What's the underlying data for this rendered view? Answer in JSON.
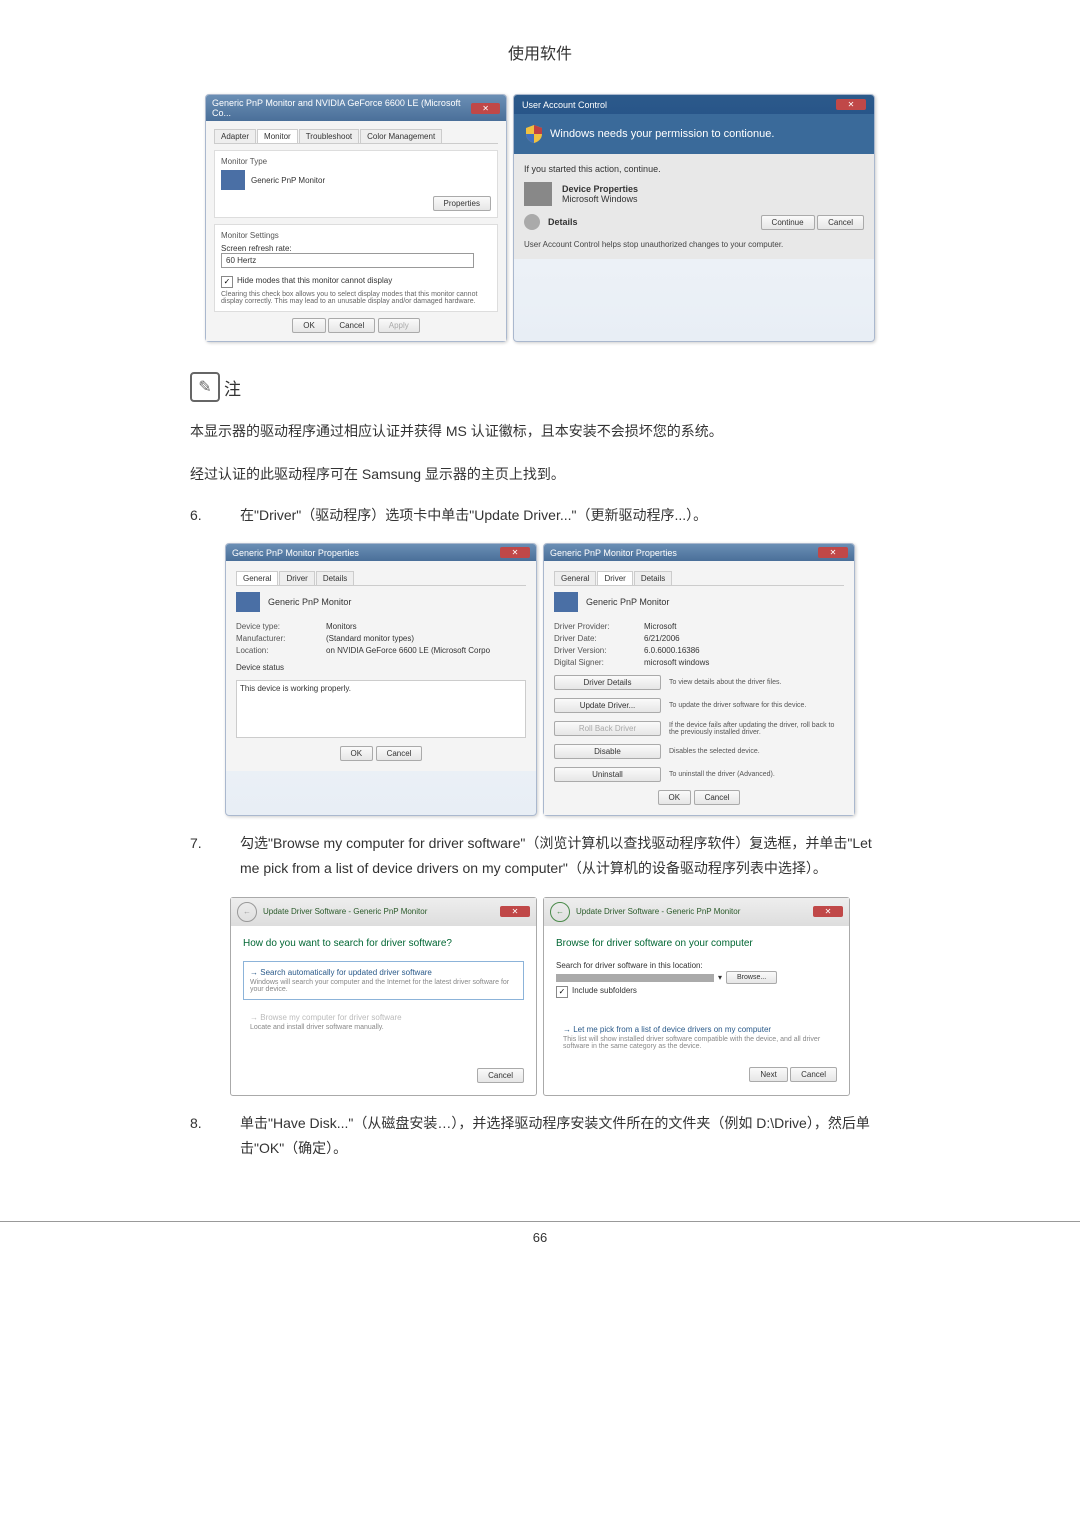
{
  "header": {
    "title": "使用软件"
  },
  "shot1": {
    "title": "Generic PnP Monitor and NVIDIA GeForce 6600 LE (Microsoft Co...",
    "tabs": [
      "Adapter",
      "Monitor",
      "Troubleshoot",
      "Color Management"
    ],
    "monitorType": "Monitor Type",
    "deviceName": "Generic PnP Monitor",
    "propertiesBtn": "Properties",
    "settingsTitle": "Monitor Settings",
    "refreshLabel": "Screen refresh rate:",
    "refreshValue": "60 Hertz",
    "hideModes": "Hide modes that this monitor cannot display",
    "hideDesc": "Clearing this check box allows you to select display modes that this monitor cannot display correctly. This may lead to an unusable display and/or damaged hardware.",
    "ok": "OK",
    "cancel": "Cancel",
    "apply": "Apply"
  },
  "uac": {
    "title": "User Account Control",
    "banner": "Windows needs your permission to contionue.",
    "ifStarted": "If you started this action, continue.",
    "devProps": "Device Properties",
    "msWindows": "Microsoft Windows",
    "details": "Details",
    "continue": "Continue",
    "cancel": "Cancel",
    "footer": "User Account Control helps stop unauthorized changes to your computer."
  },
  "note": {
    "label": "注"
  },
  "para1": "本显示器的驱动程序通过相应认证并获得 MS 认证徽标，且本安装不会损坏您的系统。",
  "para2": "经过认证的此驱动程序可在 Samsung 显示器的主页上找到。",
  "step6": {
    "num": "6.",
    "text": "在\"Driver\"（驱动程序）选项卡中单击\"Update Driver...\"（更新驱动程序...）。"
  },
  "propGeneral": {
    "title": "Generic PnP Monitor Properties",
    "tabs": [
      "General",
      "Driver",
      "Details"
    ],
    "name": "Generic PnP Monitor",
    "devType": "Device type:",
    "devTypeVal": "Monitors",
    "mfr": "Manufacturer:",
    "mfrVal": "(Standard monitor types)",
    "loc": "Location:",
    "locVal": "on NVIDIA GeForce 6600 LE (Microsoft Corpo",
    "statusLabel": "Device status",
    "statusText": "This device is working properly.",
    "ok": "OK",
    "cancel": "Cancel"
  },
  "propDriver": {
    "title": "Generic PnP Monitor Properties",
    "tabs": [
      "General",
      "Driver",
      "Details"
    ],
    "name": "Generic PnP Monitor",
    "provider": "Driver Provider:",
    "providerVal": "Microsoft",
    "date": "Driver Date:",
    "dateVal": "6/21/2006",
    "version": "Driver Version:",
    "versionVal": "6.0.6000.16386",
    "signer": "Digital Signer:",
    "signerVal": "microsoft windows",
    "detailsBtn": "Driver Details",
    "detailsDesc": "To view details about the driver files.",
    "updateBtn": "Update Driver...",
    "updateDesc": "To update the driver software for this device.",
    "rollBtn": "Roll Back Driver",
    "rollDesc": "If the device fails after updating the driver, roll back to the previously installed driver.",
    "disableBtn": "Disable",
    "disableDesc": "Disables the selected device.",
    "uninstallBtn": "Uninstall",
    "uninstallDesc": "To uninstall the driver (Advanced).",
    "ok": "OK",
    "cancel": "Cancel"
  },
  "step7": {
    "num": "7.",
    "text": "勾选\"Browse my computer for driver software\"（浏览计算机以查找驱动程序软件）复选框，并单击\"Let me pick from a list of device drivers on my computer\"（从计算机的设备驱动程序列表中选择）。"
  },
  "wiz1": {
    "nav": "Update Driver Software - Generic PnP Monitor",
    "heading": "How do you want to search for driver software?",
    "opt1": "Search automatically for updated driver software",
    "opt1Desc": "Windows will search your computer and the Internet for the latest driver software for your device.",
    "opt2": "Browse my computer for driver software",
    "opt2Desc": "Locate and install driver software manually.",
    "cancel": "Cancel"
  },
  "wiz2": {
    "nav": "Update Driver Software - Generic PnP Monitor",
    "heading": "Browse for driver software on your computer",
    "searchLabel": "Search for driver software in this location:",
    "browseBtn": "Browse...",
    "include": "Include subfolders",
    "letMe": "Let me pick from a list of device drivers on my computer",
    "letMeDesc": "This list will show installed driver software compatible with the device, and all driver software in the same category as the device.",
    "next": "Next",
    "cancel": "Cancel"
  },
  "step8": {
    "num": "8.",
    "text": "单击\"Have Disk...\"（从磁盘安装…），并选择驱动程序安装文件所在的文件夹（例如 D:\\Drive），然后单击\"OK\"（确定）。"
  },
  "pageNum": "66"
}
